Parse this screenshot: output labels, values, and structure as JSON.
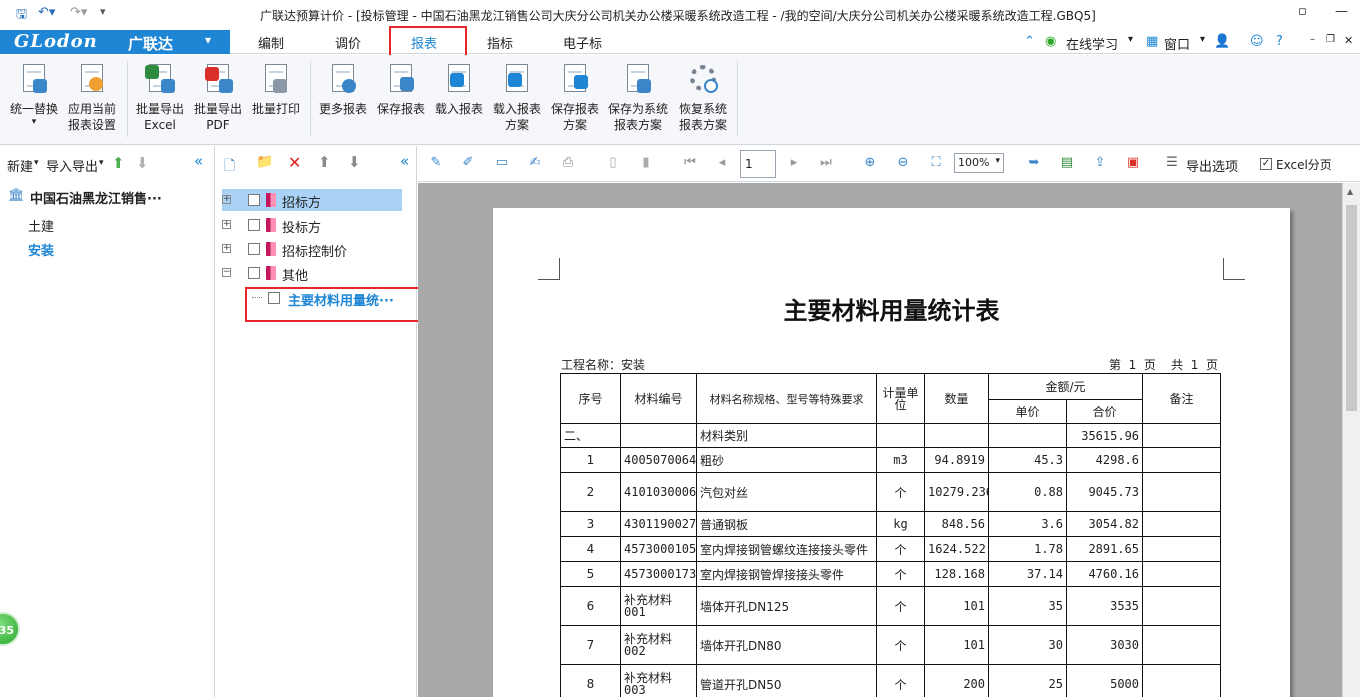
{
  "window": {
    "title": "广联达预算计价 - [投标管理 - 中国石油黑龙江销售公司大庆分公司机关办公楼采暖系统改造工程 - /我的空间/大庆分公司机关办公楼采暖系统改造工程.GBQ5]",
    "restore": "▫",
    "min": "—",
    "close": "✕"
  },
  "brand": {
    "logo": "GLodon",
    "cn": "广联达",
    "caret": "▾"
  },
  "menu": {
    "tabs": [
      "编制",
      "调价",
      "报表",
      "指标",
      "电子标"
    ],
    "active": "报表",
    "online": "在线学习",
    "window": "窗口",
    "help": "?"
  },
  "ribbon": {
    "b1": [
      "统一替换",
      "▾"
    ],
    "b2": [
      "应用当前",
      "报表设置"
    ],
    "b3": [
      "批量导出",
      "Excel"
    ],
    "b4": [
      "批量导出",
      "PDF"
    ],
    "b5": [
      "批量打印",
      ""
    ],
    "b6": [
      "更多报表",
      ""
    ],
    "b7": [
      "保存报表",
      ""
    ],
    "b8": [
      "载入报表",
      ""
    ],
    "b9": [
      "载入报表",
      "方案"
    ],
    "b10": [
      "保存报表",
      "方案"
    ],
    "b11": [
      "保存为系统",
      "报表方案"
    ],
    "b12": [
      "恢复系统",
      "报表方案"
    ]
  },
  "left": {
    "new": "新建",
    "import_export": "导入导出",
    "root": "中国石油黑龙江销售···",
    "sub1": "土建",
    "sub2": "安装",
    "collapse": "《"
  },
  "tree": {
    "n1": "招标方",
    "n2": "投标方",
    "n3": "招标控制价",
    "n4": "其他",
    "n5": "主要材料用量统···"
  },
  "toolbar": {
    "page": "1",
    "zoom": "100%",
    "export_options": "导出选项",
    "excel_paging": "Excel分页"
  },
  "report": {
    "title": "主要材料用量统计表",
    "project": "工程名称：安装",
    "page": "第  1  页    共  1  页",
    "headers": {
      "seq": "序号",
      "code": "材料编号",
      "name": "材料名称规格、型号等特殊要求",
      "unit": "计量单位",
      "qty": "数量",
      "amount": "金额/元",
      "price": "单价",
      "total": "合价",
      "remark": "备注"
    },
    "rows": [
      [
        "二、",
        "",
        "材料类别",
        "",
        "",
        "",
        "35615.96",
        ""
      ],
      [
        "1",
        "4005070064",
        "粗砂",
        "m3",
        "94.8919",
        "45.3",
        "4298.6",
        ""
      ],
      [
        "2",
        "4101030006",
        "汽包对丝",
        "个",
        "10279.236",
        "0.88",
        "9045.73",
        ""
      ],
      [
        "3",
        "4301190027",
        "普通钢板",
        "kg",
        "848.56",
        "3.6",
        "3054.82",
        ""
      ],
      [
        "4",
        "4573000105",
        "室内焊接钢管螺纹连接接头零件",
        "个",
        "1624.522",
        "1.78",
        "2891.65",
        ""
      ],
      [
        "5",
        "4573000173",
        "室内焊接钢管焊接接头零件",
        "个",
        "128.168",
        "37.14",
        "4760.16",
        ""
      ],
      [
        "6",
        "补充材料001",
        "墙体开孔DN125",
        "个",
        "101",
        "35",
        "3535",
        ""
      ],
      [
        "7",
        "补充材料002",
        "墙体开孔DN80",
        "个",
        "101",
        "30",
        "3030",
        ""
      ],
      [
        "8",
        "补充材料003",
        "管道开孔DN50",
        "个",
        "200",
        "25",
        "5000",
        ""
      ]
    ]
  },
  "float_ball": "35",
  "colors": {
    "brand": "#1e86d4",
    "highlight": "#e8252b",
    "selected": "#a9d2f6"
  }
}
